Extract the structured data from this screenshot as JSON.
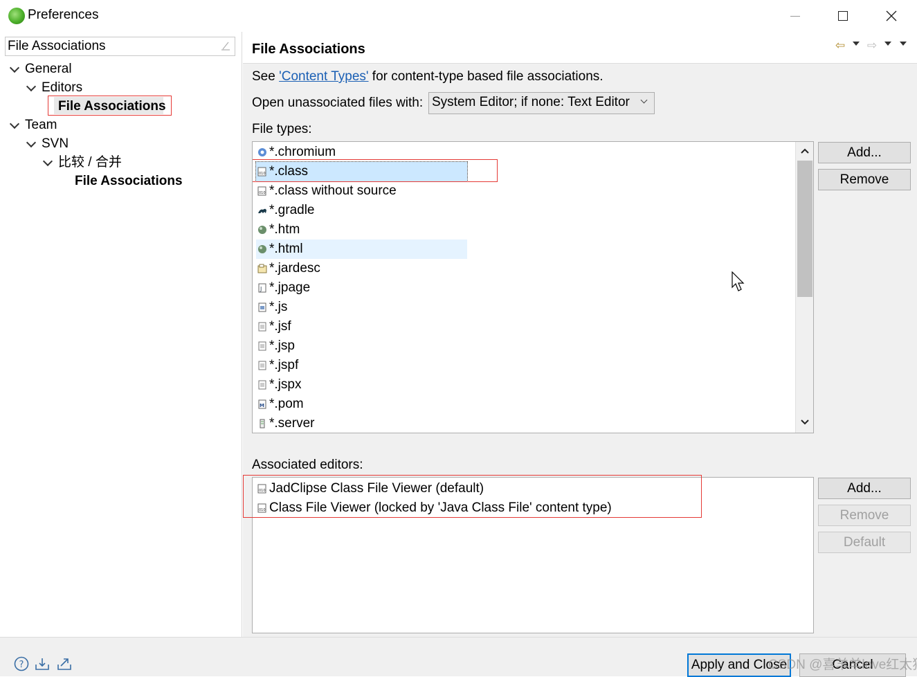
{
  "window": {
    "title": "Preferences",
    "minimize_glyph": "—",
    "maximize_glyph": "☐",
    "close_glyph": "✕"
  },
  "left": {
    "filter_value": "File Associations",
    "tree": [
      {
        "label": "General",
        "level": 0,
        "expanded": true
      },
      {
        "label": "Editors",
        "level": 1,
        "expanded": true
      },
      {
        "label": "File Associations",
        "level": 2,
        "selected": true
      },
      {
        "label": "Team",
        "level": 0,
        "expanded": true
      },
      {
        "label": "SVN",
        "level": 1,
        "expanded": true
      },
      {
        "label": "比较 / 合并",
        "level": 2,
        "expanded": true
      },
      {
        "label": "File Associations",
        "level": 3
      }
    ]
  },
  "page": {
    "title": "File Associations",
    "see_prefix": "See ",
    "see_link": "'Content Types'",
    "see_suffix": " for content-type based file associations.",
    "open_label": "Open unassociated files with:",
    "open_value": "System Editor; if none: Text Editor",
    "file_types_label": "File types:",
    "file_types": [
      {
        "name": "*.chromium",
        "icon": "chromium-icon"
      },
      {
        "name": "*.class",
        "icon": "class-file-icon",
        "selected": true
      },
      {
        "name": "*.class without source",
        "icon": "class-file-icon"
      },
      {
        "name": "*.gradle",
        "icon": "gradle-icon"
      },
      {
        "name": "*.htm",
        "icon": "web-globe-icon"
      },
      {
        "name": "*.html",
        "icon": "web-globe-icon",
        "hover": true
      },
      {
        "name": "*.jardesc",
        "icon": "jar-icon"
      },
      {
        "name": "*.jpage",
        "icon": "jpage-icon"
      },
      {
        "name": "*.js",
        "icon": "js-file-icon"
      },
      {
        "name": "*.jsf",
        "icon": "text-file-icon"
      },
      {
        "name": "*.jsp",
        "icon": "text-file-icon"
      },
      {
        "name": "*.jspf",
        "icon": "text-file-icon"
      },
      {
        "name": "*.jspx",
        "icon": "text-file-icon"
      },
      {
        "name": "*.pom",
        "icon": "maven-icon"
      },
      {
        "name": "*.server",
        "icon": "server-icon"
      }
    ],
    "ft_add": "Add...",
    "ft_remove": "Remove",
    "assoc_label": "Associated editors:",
    "assoc_editors": [
      {
        "name": "JadClipse Class File Viewer (default)",
        "icon": "class-file-icon"
      },
      {
        "name": "Class File Viewer (locked by 'Java Class File' content type)",
        "icon": "class-file-icon"
      }
    ],
    "ae_add": "Add...",
    "ae_remove": "Remove",
    "ae_default": "Default"
  },
  "footer": {
    "apply_close": "Apply and Close",
    "cancel": "Cancel",
    "watermark": "CSDN @喜羊羊love红太狼"
  },
  "colors": {
    "highlight_border": "#e53935",
    "selection": "#cce8ff",
    "hover": "#e5f3ff",
    "link": "#1a5fb4",
    "focus": "#0078d7"
  }
}
